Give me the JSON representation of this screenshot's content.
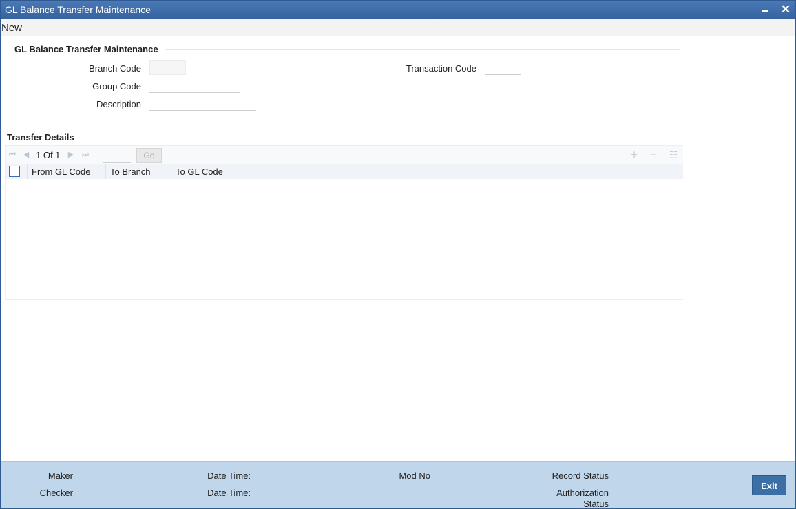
{
  "window": {
    "title": "GL Balance Transfer Maintenance"
  },
  "menu": {
    "new_label": "New"
  },
  "form": {
    "section_title": "GL Balance Transfer Maintenance",
    "branch_code_label": "Branch Code",
    "branch_code_value": "",
    "transaction_code_label": "Transaction Code",
    "transaction_code_value": "",
    "group_code_label": "Group Code",
    "group_code_value": "",
    "description_label": "Description",
    "description_value": ""
  },
  "grid": {
    "title": "Transfer Details",
    "pager_text": "1 Of 1",
    "page_input_value": "",
    "go_label": "Go",
    "columns": [
      "From GL Code",
      "To Branch",
      "To GL Code"
    ],
    "rows": []
  },
  "footer": {
    "maker_label": "Maker",
    "checker_label": "Checker",
    "date_time_label_1": "Date Time:",
    "date_time_label_2": "Date Time:",
    "mod_no_label": "Mod No",
    "record_status_label": "Record Status",
    "authorization_label": "Authorization",
    "status_label": "Status",
    "exit_label": "Exit"
  },
  "colors": {
    "titlebar": "#3f6ea9",
    "footer": "#c0d6ea",
    "exit_button": "#3d6fa7"
  },
  "icons": [
    "minimize-icon",
    "close-icon",
    "first-page-icon",
    "previous-page-icon",
    "next-page-icon",
    "last-page-icon",
    "add-row-icon",
    "delete-row-icon",
    "single-view-icon"
  ]
}
